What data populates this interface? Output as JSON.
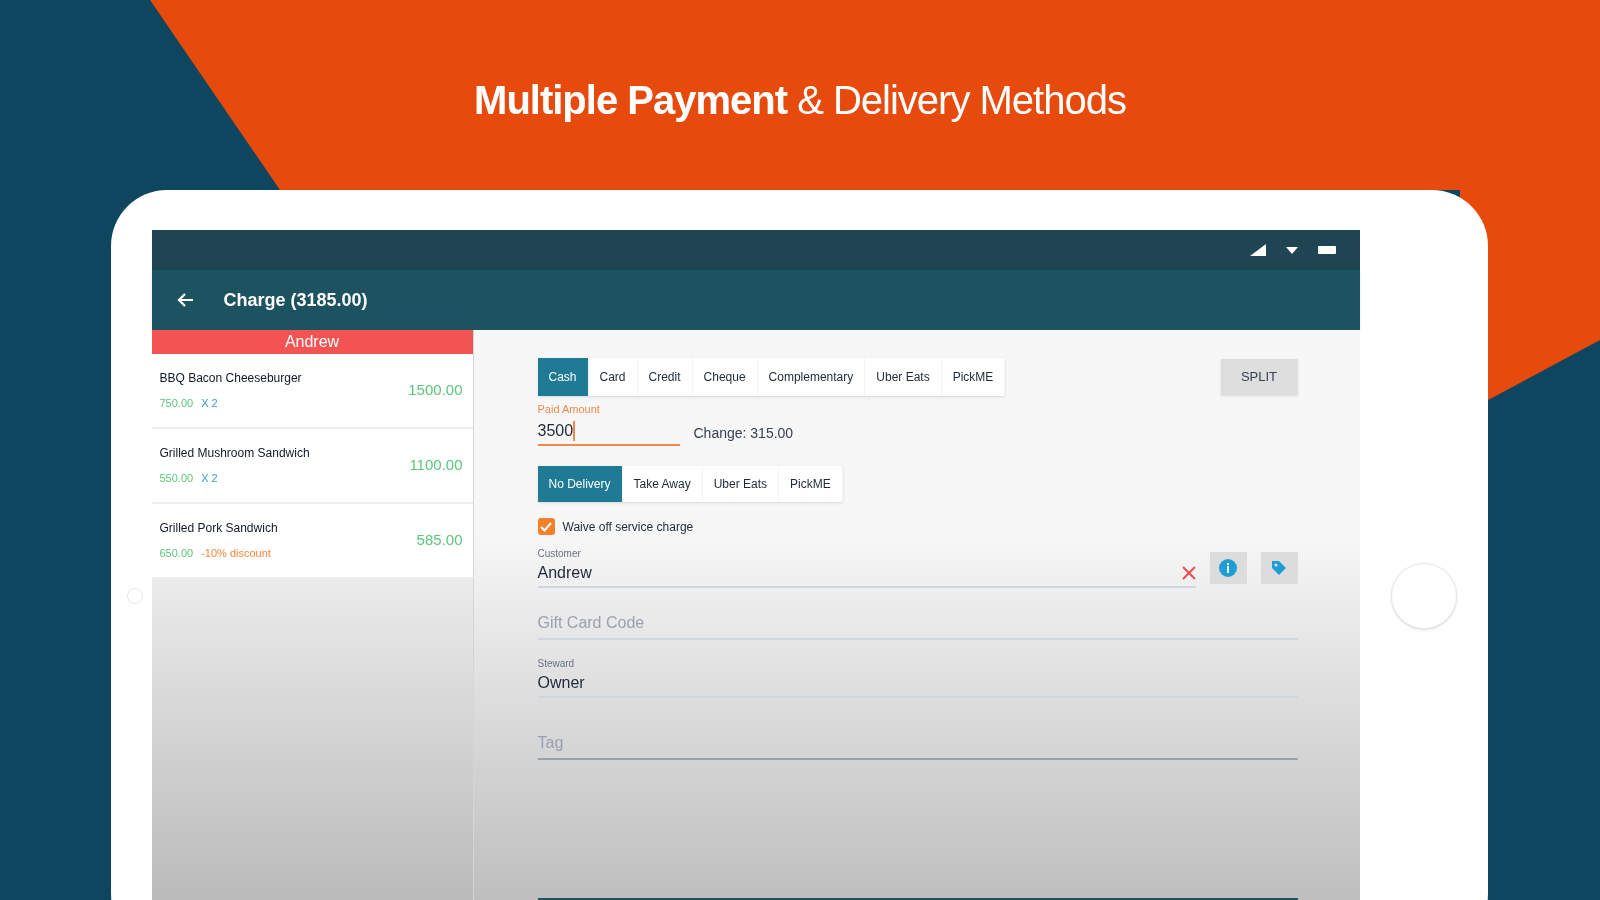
{
  "headline": "**Multiple Payment** & Delivery Methods",
  "app_bar": {
    "title": "Charge (3185.00)"
  },
  "order": {
    "customer": "Andrew",
    "items": [
      {
        "name": "BBQ Bacon Cheeseburger",
        "unit_price": "750.00",
        "note": "X 2",
        "kind": "quantity",
        "total": "1500.00"
      },
      {
        "name": "Grilled Mushroom Sandwich",
        "unit_price": "550.00",
        "note": "X 2",
        "kind": "quantity",
        "total": "1100.00"
      },
      {
        "name": "Grilled Pork Sandwich",
        "unit_price": "650.00",
        "note": "-10% discount",
        "kind": "discount",
        "total": "585.00"
      }
    ]
  },
  "payment_methods": [
    {
      "label": "Cash",
      "selected": true
    },
    {
      "label": "Card",
      "selected": false
    },
    {
      "label": "Credit",
      "selected": false
    },
    {
      "label": "Cheque",
      "selected": false
    },
    {
      "label": "Complementary",
      "selected": false
    },
    {
      "label": "Uber Eats",
      "selected": false
    },
    {
      "label": "PickME",
      "selected": false
    }
  ],
  "split_button": "SPLIT",
  "paid_amount": {
    "label": "Paid Amount",
    "value": "3500"
  },
  "change": "Change: 315.00",
  "delivery_methods": [
    {
      "label": "No Delivery",
      "selected": true
    },
    {
      "label": "Take Away",
      "selected": false
    },
    {
      "label": "Uber Eats",
      "selected": false
    },
    {
      "label": "PickME",
      "selected": false
    }
  ],
  "service_charge": {
    "label": "Waive off service charge",
    "checked": true
  },
  "customer": {
    "label": "Customer",
    "value": "Andrew"
  },
  "gift_card": {
    "placeholder": "Gift Card Code"
  },
  "steward": {
    "label": "Steward",
    "value": "Owner"
  },
  "tag": {
    "placeholder": "Tag"
  }
}
